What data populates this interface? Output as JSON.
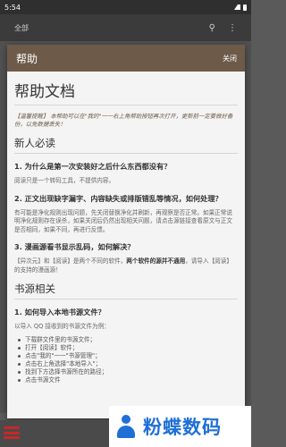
{
  "status_bar": {
    "time": "5:54"
  },
  "app_bar": {
    "title": "全部",
    "icons": [
      "search-icon",
      "more-vert-icon"
    ]
  },
  "dialog": {
    "title": "帮助",
    "close_label": "关闭",
    "doc_title": "帮助文档",
    "tip": "【温馨提醒】 本帮助可以在\"我的\"一一右上角帮助按钮再次打开，更新前一定要做好备份，以免数据丢失！",
    "section_new": "新人必读",
    "q1": "1. 为什么是第一次安装好之后什么东西都没有？",
    "a1": "阅读只是一个转码工具，不提供内容。",
    "q2": "2. 正文出现缺字漏字、内容缺失或排版错乱等情况，如何处理？",
    "a2": "有可能是净化规则出现问题，先关闭替换净化并刷新，再观察是否正常。如果正常说明净化规则存在误杀，如果关闭后仍然出现相关问题，请点击源链接查看原文与正文是否相同，如果不同，再进行反馈。",
    "q3": "3. 漫画源看书显示乱码，如何解决？",
    "a3_pre": "【异次元】和【阅读】是两个不同的软件，",
    "a3_bold": "两个软件的源并不通用",
    "a3_post": "，请导入【阅读】的支持的漫画源！",
    "section_source": "书源相关",
    "q4": "1. 如何导入本地书源文件？",
    "a4": "以导入 QQ 接收到的书源文件为例：",
    "steps": [
      "下载群文件里的书源文件；",
      "打开【阅读】软件；",
      "点击\"我的\"一一\"书源管理\"；",
      "点击右上角选择\"本地导入\"；",
      "找到下方选择书源所在的路径；",
      "点击书源文件"
    ]
  },
  "watermark": {
    "text": "粉蝶数码"
  }
}
